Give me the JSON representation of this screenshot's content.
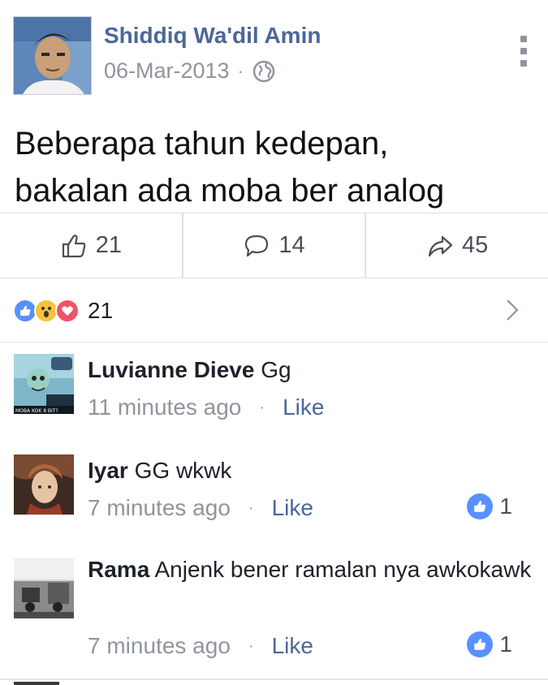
{
  "post": {
    "author": "Shiddiq Wa'dil Amin",
    "date": "06-Mar-2013",
    "separator": "·",
    "privacy_icon": "globe-icon",
    "text_line1": "Beberapa tahun kedepan,",
    "text_line2": "bakalan ada moba ber analog"
  },
  "actions": {
    "like_count": "21",
    "comment_count": "14",
    "share_count": "45"
  },
  "reactions": {
    "types": [
      "like",
      "wow",
      "love"
    ],
    "total": "21"
  },
  "comments": [
    {
      "name": "Luvianne Dieve",
      "text": "Gg",
      "time": "11 minutes ago",
      "sep": "·",
      "like_label": "Like",
      "reactions": ""
    },
    {
      "name": "Iyar",
      "text": "GG wkwk",
      "time": "7 minutes ago",
      "sep": "·",
      "like_label": "Like",
      "reactions": "1"
    },
    {
      "name": "Rama",
      "text": "Anjenk bener ramalan nya awkokawk",
      "time": "7 minutes ago",
      "sep": "·",
      "like_label": "Like",
      "reactions": "1"
    }
  ],
  "avatar_text": {
    "comment0_banner": "MOBA KOK 8 BIT?"
  },
  "colors": {
    "link": "#4b6799",
    "meta": "#90949c",
    "like_blue": "#5890ff",
    "love_red": "#f25268",
    "wow_yellow": "#f7c33a"
  }
}
